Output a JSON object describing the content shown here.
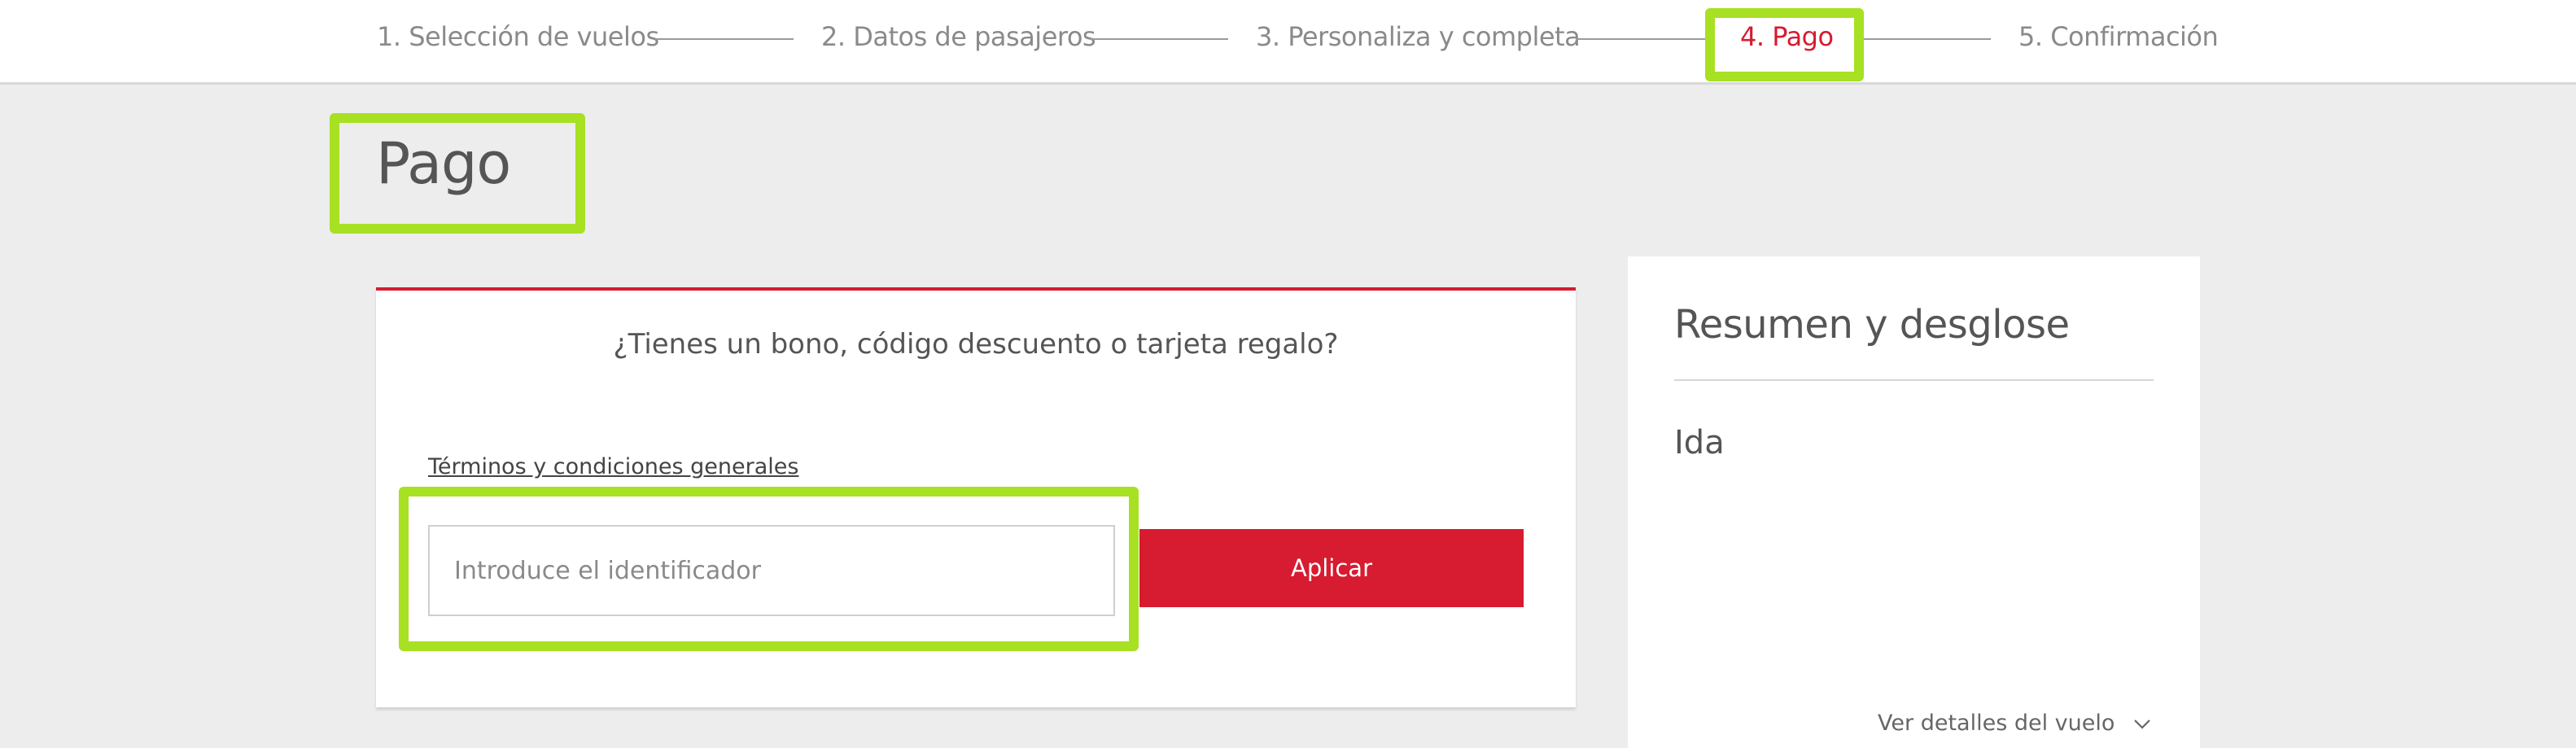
{
  "stepper": {
    "steps": [
      {
        "label": "1. Selección de vuelos"
      },
      {
        "label": "2. Datos de pasajeros"
      },
      {
        "label": "3. Personaliza y completa"
      },
      {
        "label": "4. Pago",
        "active": true
      },
      {
        "label": "5. Confirmación"
      }
    ]
  },
  "page": {
    "title": "Pago"
  },
  "voucher": {
    "question": "¿Tienes un bono, código descuento o tarjeta regalo?",
    "terms_link": "Términos y condiciones generales",
    "input_placeholder": "Introduce el identificador",
    "input_value": "",
    "apply_label": "Aplicar"
  },
  "summary": {
    "title": "Resumen y desglose",
    "leg_label": "Ida",
    "details_link": "Ver detalles del vuelo",
    "details_icon": "chevron-down-icon"
  },
  "colors": {
    "accent": "#d71b30",
    "highlight": "#a8e023",
    "background": "#ededed"
  }
}
